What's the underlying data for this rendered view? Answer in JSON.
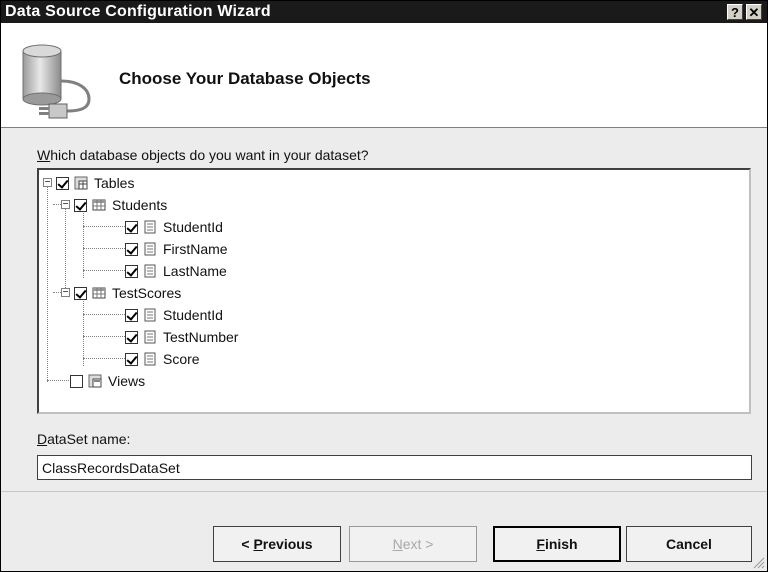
{
  "window": {
    "title": "Data Source Configuration Wizard",
    "help_label": "?",
    "close_label": "✕"
  },
  "header": {
    "title": "Choose Your Database Objects"
  },
  "prompt": {
    "accel": "W",
    "rest": "hich database objects do you want in your dataset?"
  },
  "tree": {
    "tables": {
      "label": "Tables",
      "checked": true
    },
    "students": {
      "label": "Students",
      "checked": true,
      "columns": [
        "StudentId",
        "FirstName",
        "LastName"
      ]
    },
    "testscores": {
      "label": "TestScores",
      "checked": true,
      "columns": [
        "StudentId",
        "TestNumber",
        "Score"
      ]
    },
    "views": {
      "label": "Views",
      "checked": false
    }
  },
  "dataset": {
    "label_accel": "D",
    "label_rest": "ataSet name:",
    "value": "ClassRecordsDataSet"
  },
  "buttons": {
    "previous": {
      "prefix": "< ",
      "accel": "P",
      "rest": "revious"
    },
    "next": {
      "accel": "N",
      "rest": "ext >"
    },
    "finish": {
      "accel": "F",
      "rest": "inish"
    },
    "cancel": "Cancel"
  },
  "colors": {
    "titlebar": "#1a1a1a",
    "dialog": "#ececec",
    "header": "#ffffff"
  }
}
